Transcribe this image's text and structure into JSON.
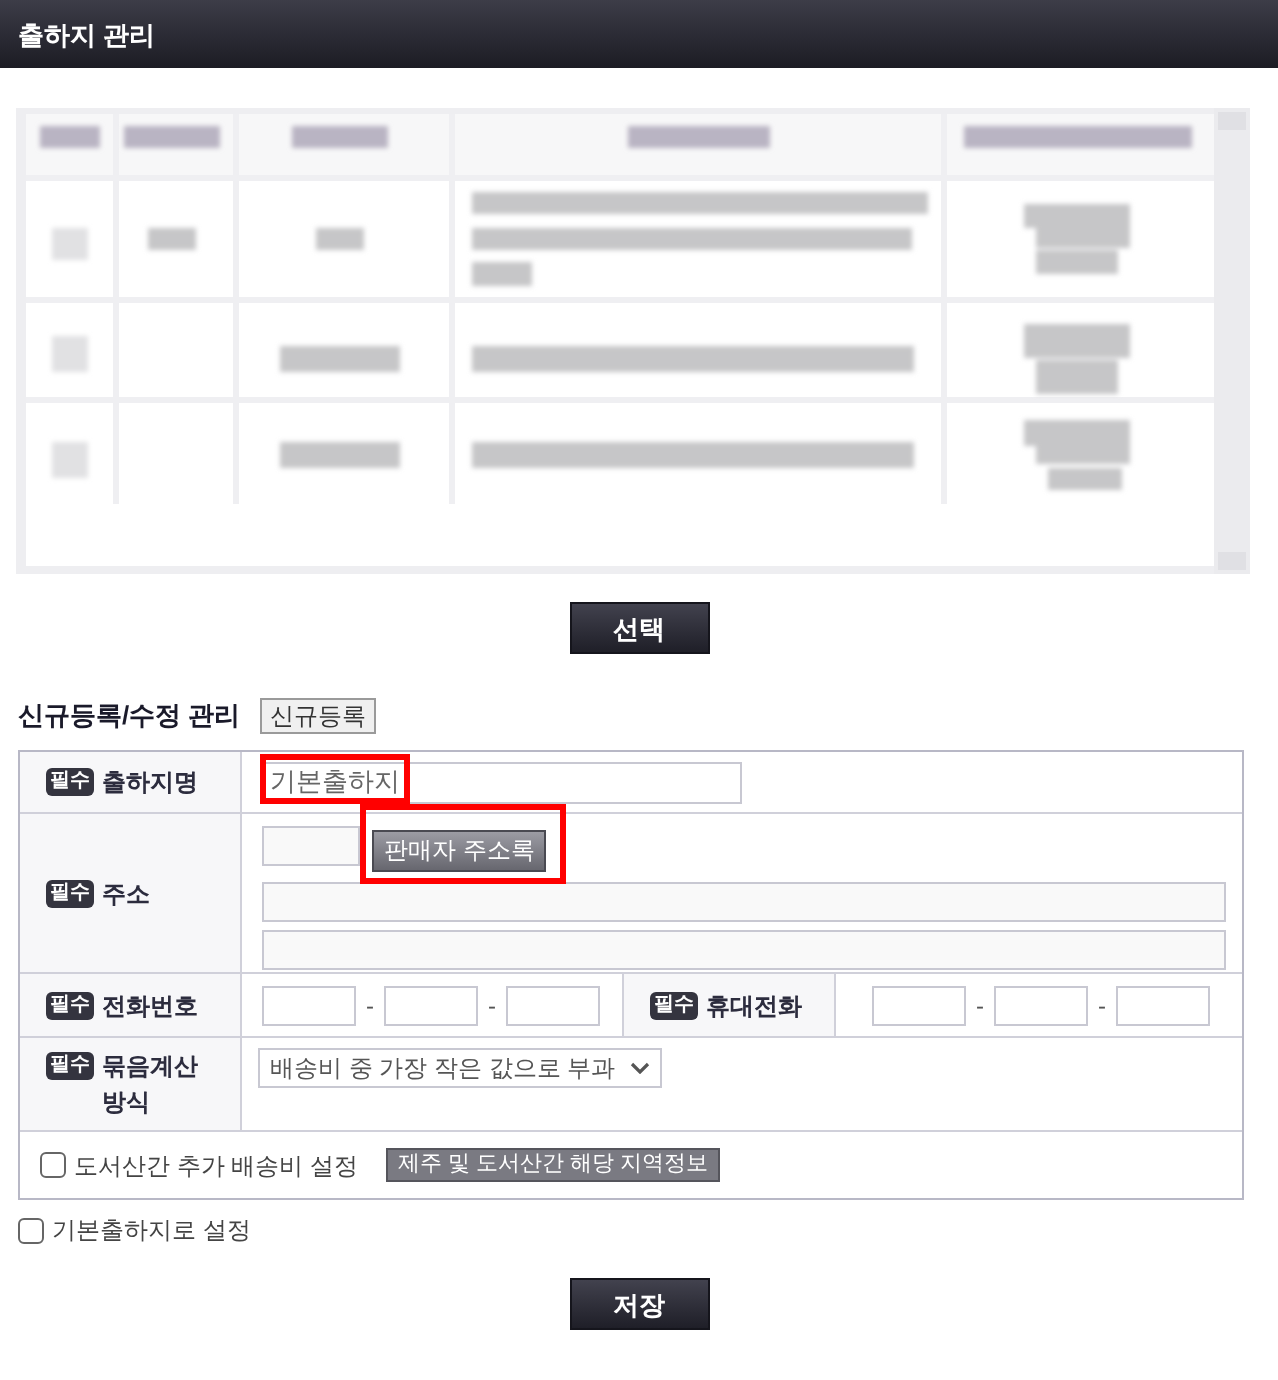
{
  "header": {
    "title": "출하지 관리"
  },
  "address_list": {
    "redacted": true
  },
  "select_button": {
    "label": "선택"
  },
  "registration": {
    "title": "신규등록/수정 관리",
    "new_button": "신규등록"
  },
  "form": {
    "rows": [
      {
        "kind": "text",
        "required_badge": "필수",
        "label": "출하지명",
        "value": "기본출하지",
        "highlighted": true
      },
      {
        "kind": "address",
        "required_badge": "필수",
        "label": "주소",
        "button": "판매자 주소록",
        "button_highlighted": true
      },
      {
        "kind": "phone",
        "groups": [
          {
            "required_badge": "필수",
            "label": "전화번호",
            "separators": [
              "-",
              "-"
            ]
          },
          {
            "required_badge": "필수",
            "label": "휴대전화",
            "separators": [
              "-",
              "-"
            ]
          }
        ]
      },
      {
        "kind": "select",
        "required_badge": "필수",
        "label": "묶음계산 방식",
        "value": "배송비 중 가장 작은 값으로 부과"
      },
      {
        "kind": "checkbox",
        "label": "도서산간 추가 배송비 설정",
        "checked": false,
        "button": "제주 및 도서산간 해당 지역정보"
      }
    ]
  },
  "default_checkbox": {
    "label": "기본출하지로 설정",
    "checked": false
  },
  "save_button": {
    "label": "저장"
  }
}
